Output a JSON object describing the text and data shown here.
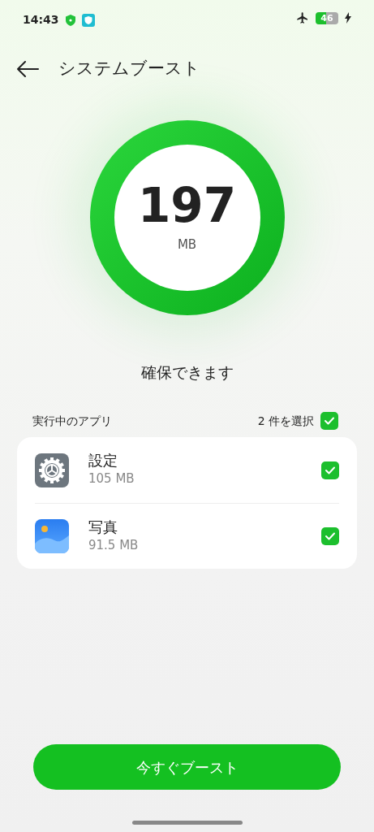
{
  "status_bar": {
    "time": "14:43",
    "battery": "46"
  },
  "header": {
    "title": "システムブースト"
  },
  "summary": {
    "amount": "197",
    "unit": "MB",
    "caption": "確保できます"
  },
  "apps_section": {
    "title": "実行中のアプリ",
    "selected_count": "2 件を選択",
    "all_checked": true
  },
  "apps": [
    {
      "kind": "settings",
      "name": "設定",
      "size": "105 MB",
      "checked": true
    },
    {
      "kind": "photos",
      "name": "写真",
      "size": "91.5 MB",
      "checked": true
    }
  ],
  "primary_button": {
    "label": "今すぐブースト"
  }
}
